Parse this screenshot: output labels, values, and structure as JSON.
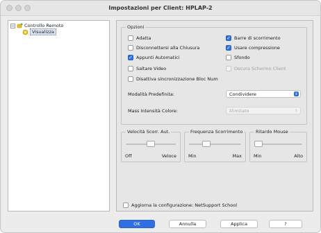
{
  "window": {
    "title": "Impostazioni per Client: HPLAP-2"
  },
  "tree": {
    "root": {
      "label": "Controllo Remoto",
      "icon": "remote-control-icon"
    },
    "child": {
      "label": "Visualizza",
      "icon": "display-icon"
    }
  },
  "options": {
    "legend": "Opzioni",
    "left": [
      {
        "label": "Adatta",
        "checked": false
      },
      {
        "label": "Disconnettersi alla Chiusura",
        "checked": false
      },
      {
        "label": "Appunti Automatici",
        "checked": true
      },
      {
        "label": "Saltare Video",
        "checked": false
      },
      {
        "label": "Disattiva sincronizzazione Bloc Num",
        "checked": false
      }
    ],
    "right": [
      {
        "label": "Barre di scorrimento",
        "checked": true
      },
      {
        "label": "Usare compressione",
        "checked": true
      },
      {
        "label": "Sfondo",
        "checked": false
      },
      {
        "label": "Oscura Schermo Client",
        "checked": false,
        "disabled": true
      }
    ],
    "default_mode": {
      "label": "Modalità Predefinita:",
      "value": "Condividere"
    },
    "color_depth": {
      "label": "Mass Intensità Colore:",
      "value": "Illimitato",
      "disabled": true
    }
  },
  "sliders": [
    {
      "legend": "Velocità Scorr. Aut.",
      "min": "Off",
      "max": "Veloce",
      "level": 0.5
    },
    {
      "legend": "Frequenza Scorrimento",
      "min": "Min",
      "max": "Max",
      "level": 0.3
    },
    {
      "legend": "Ritardo Mouse",
      "min": "Min",
      "max": "Alto",
      "level": 0.0
    }
  ],
  "update_config": {
    "label": "Aggiorna la configurazione: NetSupport School",
    "checked": false
  },
  "buttons": {
    "ok": "OK",
    "cancel": "Annulla",
    "apply": "Applica",
    "help": "?"
  },
  "colors": {
    "accent": "#2f6fe0",
    "icon_yellow": "#e8c21a"
  }
}
